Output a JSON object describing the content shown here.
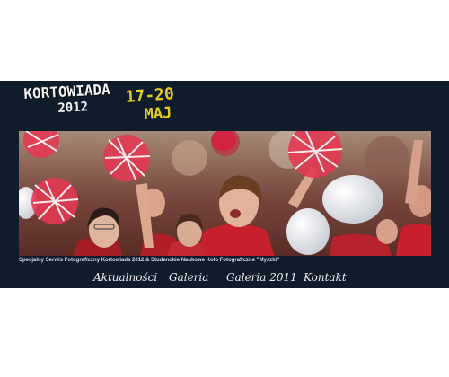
{
  "header": {
    "event_name": "KORTOWIADA",
    "year": "2012",
    "dates": "17-20",
    "month": "MAJ"
  },
  "photo": {
    "alt": "Crowd of students cheering with red and white pom-poms and balloons"
  },
  "caption": "Specjalny Serwis Fotograficzny Kortowiada 2012 & Studenckie Naukowe Koło Fotograficzne \"Myszki\"",
  "nav": {
    "items": [
      "Aktualności",
      "Galeria",
      "Galeria 2011",
      "Kontakt"
    ]
  },
  "colors": {
    "banner_bg": "#0f1c2c",
    "accent_yellow": "#e3cc1e",
    "shirt_red": "#c8202c"
  }
}
